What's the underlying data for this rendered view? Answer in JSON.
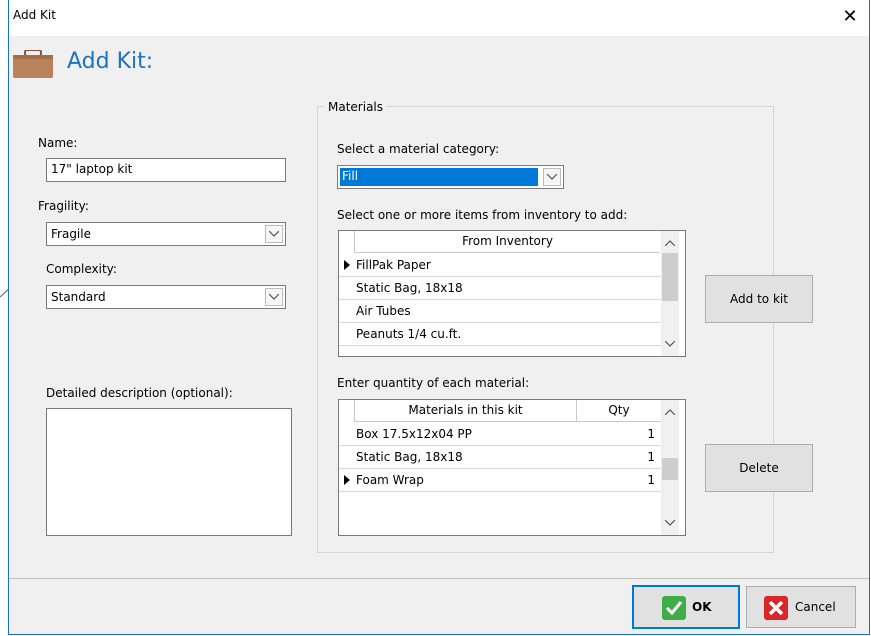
{
  "window": {
    "title": "Add Kit",
    "close_symbol": "✕"
  },
  "heading": {
    "text": "Add Kit:",
    "icon": "briefcase-icon"
  },
  "form": {
    "name_label": "Name:",
    "name_value": "17\" laptop kit",
    "fragility_label": "Fragility:",
    "fragility_value": "Fragile",
    "complexity_label": "Complexity:",
    "complexity_value": "Standard",
    "description_label": "Detailed description (optional):",
    "description_value": ""
  },
  "materials": {
    "group_label": "Materials",
    "category_label": "Select a material category:",
    "category_value": "Fill",
    "inventory_label": "Select one or more items from inventory to add:",
    "inventory_header": "From Inventory",
    "inventory_items": [
      "FillPak Paper",
      "Static Bag, 18x18",
      "Air Tubes",
      "Peanuts 1/4 cu.ft."
    ],
    "add_button": "Add to kit",
    "quantity_label": "Enter quantity of each material:",
    "kit_header_name": "Materials in this kit",
    "kit_header_qty": "Qty",
    "kit_items": [
      {
        "name": "Box 17.5x12x04 PP",
        "qty": "1"
      },
      {
        "name": "Static Bag, 18x18",
        "qty": "1"
      },
      {
        "name": "Foam Wrap",
        "qty": "1"
      }
    ],
    "delete_button": "Delete"
  },
  "footer": {
    "ok_label": "OK",
    "cancel_label": "Cancel"
  },
  "colors": {
    "accent": "#1a73c2",
    "selection": "#0078d7",
    "ok_green": "#3fae49",
    "cancel_red": "#d9262b"
  }
}
